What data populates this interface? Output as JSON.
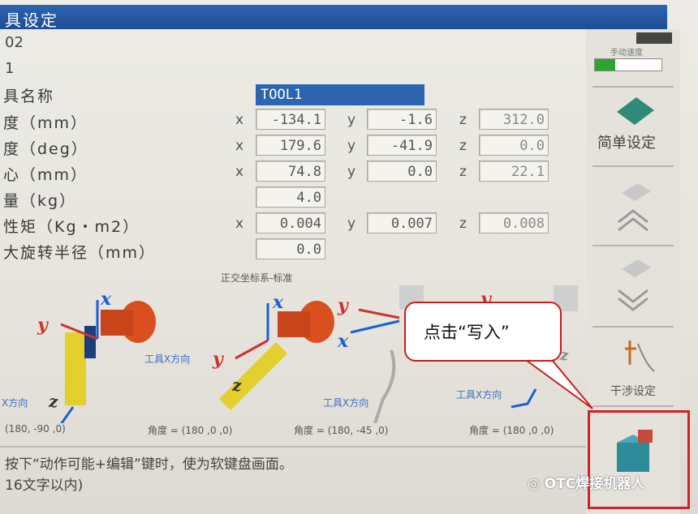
{
  "window": {
    "title": "具设定"
  },
  "header": {
    "number": "02",
    "mark": "1"
  },
  "tool_name": {
    "label": "具名称",
    "value": "TOOL1"
  },
  "rows": [
    {
      "label": "度（mm）",
      "x_axis": "x",
      "x": "-134.1",
      "y_axis": "y",
      "y": "-1.6",
      "z_axis": "z",
      "z": "312.0"
    },
    {
      "label": "度（deg）",
      "x_axis": "x",
      "x": "179.6",
      "y_axis": "y",
      "y": "-41.9",
      "z_axis": "z",
      "z": "0.0"
    },
    {
      "label": "心（mm）",
      "x_axis": "x",
      "x": "74.8",
      "y_axis": "y",
      "y": "0.0",
      "z_axis": "z",
      "z": "22.1"
    },
    {
      "label": "量（kg）",
      "value": "4.0"
    },
    {
      "label": "性矩（Kg・m2）",
      "x_axis": "x",
      "x": "0.004",
      "y_axis": "y",
      "y": "0.007",
      "z_axis": "z",
      "z": "0.008"
    },
    {
      "label": "大旋转半径（mm）",
      "value": "0.0"
    }
  ],
  "diagram": {
    "subtitle": "正交坐标系-标准",
    "tool_x_label": "工具X方向",
    "tool_x_label_left": "X方向",
    "angle_prefix": "角度 = ",
    "angles": [
      "(180, -90 ,0)",
      "(180 ,0 ,0)",
      "(180, -45 ,0)",
      "(180 ,0 ,0)"
    ],
    "axis_x": "x",
    "axis_y": "y",
    "axis_z": "z"
  },
  "footer": {
    "line1": "按下“动作可能+编辑”键时，使为软键盘画面。",
    "line2": "16文字以内)"
  },
  "sidebar": {
    "status": "手动速度",
    "simple_setting": "简单设定",
    "interference": "干涉设定"
  },
  "callout": {
    "text": "点击“写入”"
  },
  "watermark": {
    "text": "OTC焊接机器人"
  },
  "colors": {
    "accent": "#2d64b0",
    "highlight": "#d42020",
    "bubble_border": "#c81e1e"
  }
}
